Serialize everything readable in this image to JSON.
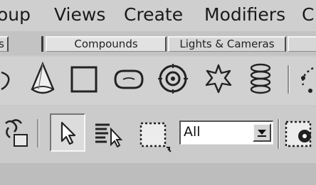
{
  "menu": {
    "items": [
      {
        "label": "oup"
      },
      {
        "label": "Views"
      },
      {
        "label": "Create"
      },
      {
        "label": "Modifiers"
      },
      {
        "label": "C"
      }
    ]
  },
  "tabs": {
    "items": [
      {
        "label": "s"
      },
      {
        "label": "Compounds"
      },
      {
        "label": "Lights & Cameras"
      },
      {
        "label": ""
      }
    ]
  },
  "shapes_toolbar": {
    "icons": [
      "partial-shape-icon",
      "cone-icon",
      "box-icon",
      "torus-icon",
      "target-icon",
      "star-icon",
      "helix-icon",
      "partial-particles-icon"
    ]
  },
  "main_toolbar": {
    "icons": [
      "link-icon",
      "select-arrow-icon",
      "select-by-name-icon",
      "selection-region-icon",
      "window-crossing-icon"
    ],
    "selection_filter": {
      "value": "All"
    }
  }
}
